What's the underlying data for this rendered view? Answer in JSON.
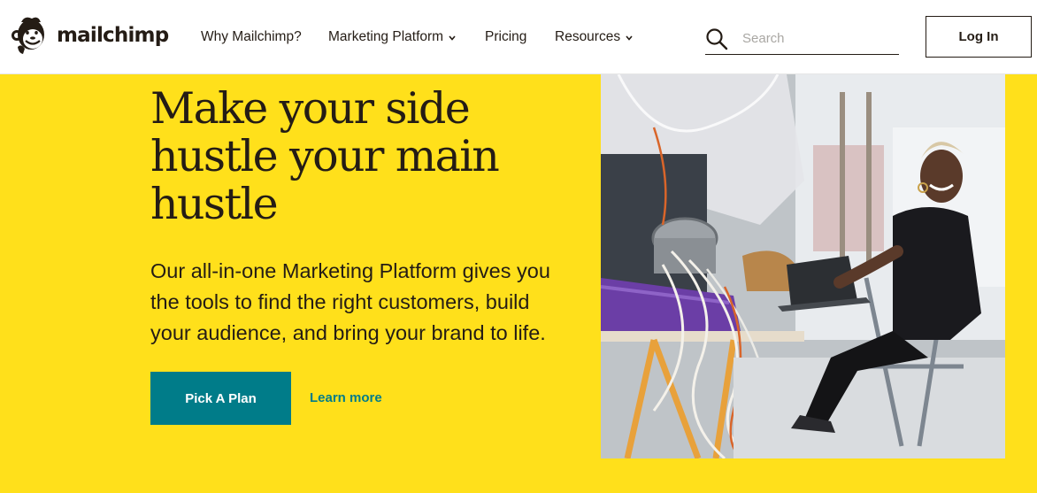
{
  "header": {
    "logo_text": "mailchimp",
    "nav": [
      {
        "label": "Why Mailchimp?",
        "has_dropdown": false
      },
      {
        "label": "Marketing Platform",
        "has_dropdown": true
      },
      {
        "label": "Pricing",
        "has_dropdown": false
      },
      {
        "label": "Resources",
        "has_dropdown": true
      }
    ],
    "search": {
      "placeholder": "Search",
      "value": ""
    },
    "login_label": "Log In"
  },
  "hero": {
    "headline": "Make your side hustle your main hustle",
    "subtext": "Our all-in-one Marketing Platform gives you the tools to find the right customers, build your audience, and bring your brand to life.",
    "primary_button": "Pick A Plan",
    "secondary_link": "Learn more"
  },
  "colors": {
    "brand_yellow": "#ffe01b",
    "teal": "#007c89",
    "ink": "#241c15"
  },
  "icons": {
    "logo": "freddie-chimp-icon",
    "search": "search-icon",
    "dropdown": "chevron-down-icon"
  }
}
